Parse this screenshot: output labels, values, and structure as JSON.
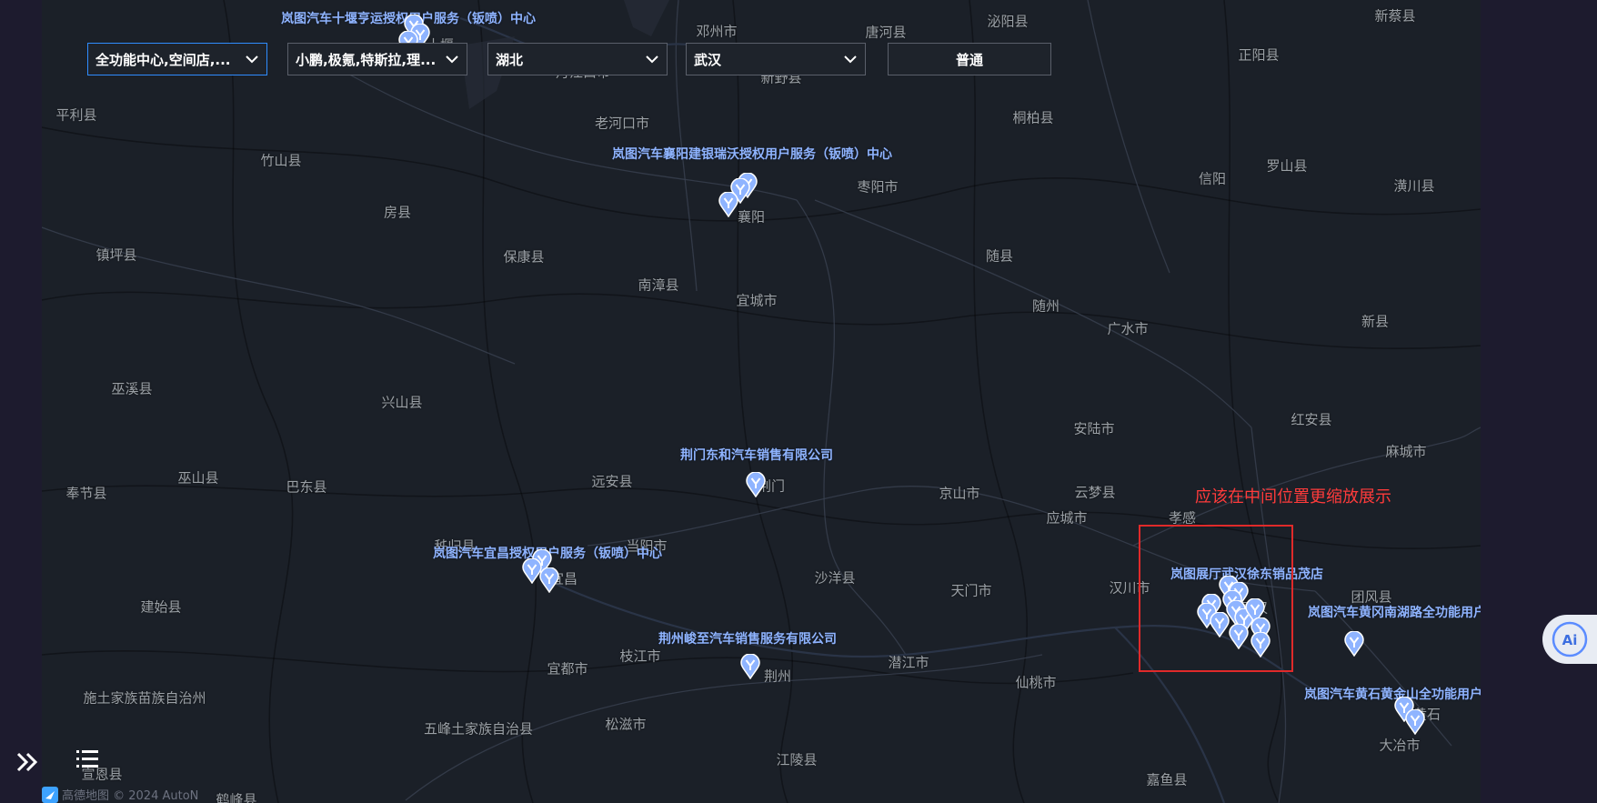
{
  "filters": {
    "function_type": "全功能中心,空间店,...",
    "brands": "小鹏,极氪,特斯拉,理...",
    "province": "湖北",
    "city": "武汉",
    "mode_button": "普通"
  },
  "annotation": {
    "note": "应该在中间位置更缩放展示",
    "color": "#ff3b3b"
  },
  "cities": [
    "丹江口市",
    "十堰",
    "邓州市",
    "唐河县",
    "泌阳县",
    "新蔡县",
    "正阳县",
    "新野县",
    "老河口市",
    "桐柏县",
    "平利县",
    "竹山县",
    "房县",
    "襄阳",
    "枣阳市",
    "信阳",
    "罗山县",
    "潢川县",
    "镇坪县",
    "保康县",
    "南漳县",
    "宜城市",
    "随县",
    "随州",
    "广水市",
    "新县",
    "巫溪县",
    "兴山县",
    "安陆市",
    "红安县",
    "麻城市",
    "荆门",
    "远安县",
    "京山市",
    "云梦县",
    "孝感",
    "应城市",
    "奉节县",
    "巫山县",
    "巴东县",
    "秭归县",
    "当阳市",
    "宜昌",
    "沙洋县",
    "天门市",
    "汉川市",
    "武汉",
    "团风县",
    "建始县",
    "宜都市",
    "枝江市",
    "荆州",
    "潜江市",
    "仙桃市",
    "黄石",
    "大冶市",
    "施土家族苗族自治州",
    "五峰土家族自治县",
    "松滋市",
    "江陵县",
    "嘉鱼县",
    "宣恩县",
    "鹤峰县"
  ],
  "poi_labels": [
    "岚图汽车十堰亨运授权用户服务（钣喷）中心",
    "岚图汽车襄阳建银瑞沃授权用户服务（钣喷）中心",
    "荆门东和汽车销售有限公司",
    "岚图汽车宜昌授权用户服务（钣喷）中心",
    "荆州峻至汽车销售服务有限公司",
    "岚图展厅武汉徐东销品茂店",
    "岚图汽车黄冈南湖路全功能用户",
    "岚图汽车黄石黄金山全功能用户"
  ],
  "attribution": "高德地图 © 2024 AutoN",
  "colors": {
    "map_bg": "#1b2028",
    "pin": "#8fb4ff",
    "annotation_box": "#e02a2a"
  },
  "icons": [
    "expand-icon",
    "list-icon",
    "ai-icon",
    "amap-logo-icon",
    "map-pin-icon",
    "chevron-down-icon"
  ]
}
